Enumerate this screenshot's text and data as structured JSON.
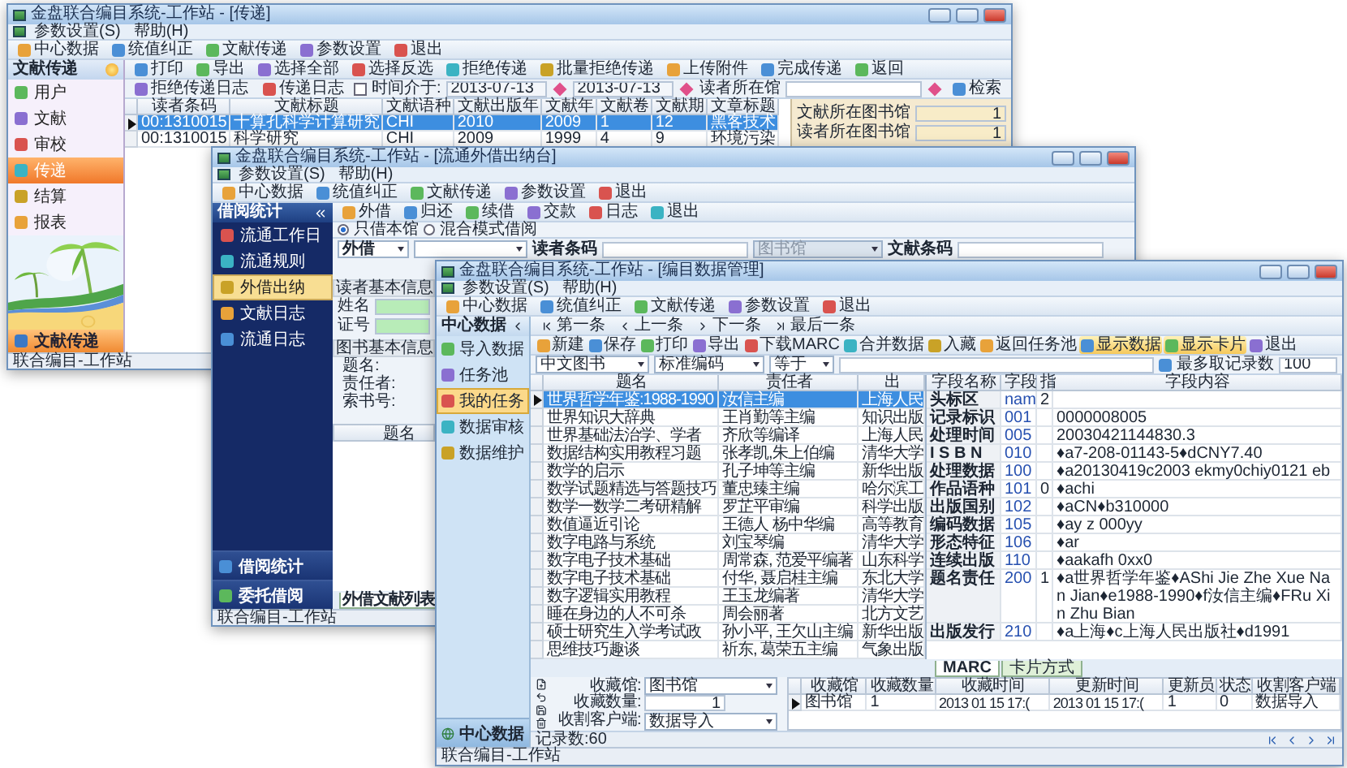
{
  "transfer_window": {
    "title": "金盘联合编目系统-工作站 - [传递]",
    "menu": [
      "参数设置(S)",
      "帮助(H)"
    ],
    "toolbar": [
      "中心数据",
      "统值纠正",
      "文献传递",
      "参数设置",
      "退出"
    ],
    "sidebar": {
      "title": "文献传递",
      "items": [
        {
          "label": "用户",
          "selected": false
        },
        {
          "label": "文献",
          "selected": false
        },
        {
          "label": "审校",
          "selected": false
        },
        {
          "label": "传递",
          "selected": true
        },
        {
          "label": "结算",
          "selected": false
        },
        {
          "label": "报表",
          "selected": false
        }
      ],
      "footer": "文献传递"
    },
    "actions": [
      "打印",
      "导出",
      "选择全部",
      "选择反选",
      "拒绝传递",
      "批量拒绝传递",
      "上传附件",
      "完成传递",
      "返回"
    ],
    "filter": {
      "log_buttons": [
        "拒绝传递日志",
        "传递日志"
      ],
      "checkbox": {
        "label": "时间介于:",
        "checked": false
      },
      "date_from": "2013-07-13",
      "date_to": "2013-07-13",
      "reader_library_label": "读者所在馆",
      "search": "检索"
    },
    "table": {
      "columns": [
        "读者条码",
        "文献标题",
        "文献语种",
        "文献出版年",
        "文献年",
        "文献卷",
        "文献期",
        "文章标题"
      ],
      "rows": [
        {
          "selected": true,
          "cells": [
            "00:1310015",
            "十算孔科学计算研究",
            "CHI",
            "2010",
            "2009",
            "1",
            "12",
            "黑客技术"
          ]
        },
        {
          "selected": false,
          "cells": [
            "00:1310015",
            "科学研究",
            "CHI",
            "2009",
            "1999",
            "4",
            "9",
            "环境污染"
          ]
        }
      ]
    },
    "info": [
      {
        "label": "文献所在图书馆",
        "value": "1"
      },
      {
        "label": "读者所在图书馆",
        "value": "1"
      }
    ],
    "status": "联合编目-工作站"
  },
  "circulation_window": {
    "title": "金盘联合编目系统-工作站 - [流通外借出纳台]",
    "menu": [
      "参数设置(S)",
      "帮助(H)"
    ],
    "toolbar": [
      "中心数据",
      "统值纠正",
      "文献传递",
      "参数设置",
      "退出"
    ],
    "sidebar": {
      "title": "借阅统计",
      "items": [
        {
          "label": "流通工作日",
          "selected": false
        },
        {
          "label": "流通规则",
          "selected": false
        },
        {
          "label": "外借出纳",
          "selected": true
        },
        {
          "label": "文献日志",
          "selected": false
        },
        {
          "label": "流通日志",
          "selected": false
        }
      ],
      "footer": [
        "借阅统计",
        "委托借阅"
      ]
    },
    "actions": [
      "外借",
      "归还",
      "续借",
      "交款",
      "日志",
      "退出"
    ],
    "modes": [
      {
        "label": "只借本馆",
        "selected": true
      },
      {
        "label": "混合模式借阅",
        "selected": false
      }
    ],
    "loan_type": "外借",
    "reader_barcode_label": "读者条码",
    "library_placeholder": "图书馆",
    "item_barcode_label": "文献条码",
    "reader_section": "读者基本信息",
    "reader_fields": [
      "姓名",
      "证号"
    ],
    "book_section": "图书基本信息",
    "book_fields": [
      "题名:",
      "责任者:",
      "索书号:"
    ],
    "list_column": "题名",
    "tab": "外借文献列表",
    "status": "联合编目-工作站"
  },
  "cataloging_window": {
    "title": "金盘联合编目系统-工作站 - [编目数据管理]",
    "menu": [
      "参数设置(S)",
      "帮助(H)"
    ],
    "toolbar": [
      "中心数据",
      "统值纠正",
      "文献传递",
      "参数设置",
      "退出"
    ],
    "sidebar": {
      "title": "中心数据",
      "items": [
        {
          "label": "导入数据",
          "selected": false
        },
        {
          "label": "任务池",
          "selected": false
        },
        {
          "label": "我的任务",
          "selected": true
        },
        {
          "label": "数据审核",
          "selected": false
        },
        {
          "label": "数据维护",
          "selected": false
        }
      ],
      "footer": "中心数据"
    },
    "navigation": [
      "第一条",
      "上一条",
      "下一条",
      "最后一条"
    ],
    "actions": [
      {
        "label": "新建",
        "selected": false
      },
      {
        "label": "保存",
        "selected": false
      },
      {
        "label": "打印",
        "selected": false
      },
      {
        "label": "导出",
        "selected": false
      },
      {
        "label": "下载MARC",
        "selected": false
      },
      {
        "label": "合并数据",
        "selected": false
      },
      {
        "label": "入藏",
        "selected": false
      },
      {
        "label": "返回任务池",
        "selected": false
      },
      {
        "label": "显示数据",
        "selected": true
      },
      {
        "label": "显示卡片",
        "selected": true
      },
      {
        "label": "退出",
        "selected": false
      }
    ],
    "filter": {
      "type": "中文图书",
      "field": "标准编码",
      "operator": "等于",
      "max_label": "最多取记录数",
      "max_value": "100"
    },
    "records": {
      "columns": [
        "题名",
        "责任者",
        "出"
      ],
      "rows": [
        {
          "selected": true,
          "cells": [
            "世界哲学年鉴:1988-1990",
            "汝信主编",
            "上海人民"
          ]
        },
        {
          "selected": false,
          "cells": [
            "世界知识大辞典",
            "王肖勤等主编",
            "知识出版"
          ]
        },
        {
          "selected": false,
          "cells": [
            "世界基础法治学、学者",
            "齐欣等编译",
            "上海人民"
          ]
        },
        {
          "selected": false,
          "cells": [
            "数据结构实用教程习题",
            "张孝凯,朱上伯编",
            "清华大学"
          ]
        },
        {
          "selected": false,
          "cells": [
            "数学的启示",
            "孔子坤等主编",
            "新华出版"
          ]
        },
        {
          "selected": false,
          "cells": [
            "数学试题精选与答题技巧",
            "董忠臻主编",
            "哈尔滨工"
          ]
        },
        {
          "selected": false,
          "cells": [
            "数学一数学二考研精解",
            "罗芷平审编",
            "科学出版"
          ]
        },
        {
          "selected": false,
          "cells": [
            "数值逼近引论",
            "王德人 杨中华编",
            "高等教育"
          ]
        },
        {
          "selected": false,
          "cells": [
            "数字电路与系统",
            "刘宝琴编",
            "清华大学"
          ]
        },
        {
          "selected": false,
          "cells": [
            "数字电子技术基础",
            "周常森, 范爱平编著",
            "山东科学"
          ]
        },
        {
          "selected": false,
          "cells": [
            "数字电子技术基础",
            "付华, 聂启桂主编",
            "东北大学"
          ]
        },
        {
          "selected": false,
          "cells": [
            "数字逻辑实用教程",
            "王玉龙编著",
            "清华大学"
          ]
        },
        {
          "selected": false,
          "cells": [
            "睡在身边的人不可杀",
            "周会丽著",
            "北方文艺"
          ]
        },
        {
          "selected": false,
          "cells": [
            "硕士研究生入学考试政",
            "孙小平, 王欠山主编",
            "新华出版"
          ]
        },
        {
          "selected": false,
          "cells": [
            "思维技巧趣谈",
            "祈东, 葛荣五主编",
            "气象出版"
          ]
        }
      ]
    },
    "marc": {
      "columns": [
        "字段名称",
        "字段",
        "指",
        "字段内容"
      ],
      "rows": [
        {
          "name": "头标区",
          "tag": "nam",
          "indicator": "2"
        },
        {
          "name": "记录标识",
          "tag": "001",
          "content": "0000008005"
        },
        {
          "name": "处理时间",
          "tag": "005",
          "content": "20030421144830.3"
        },
        {
          "name": "I S B N",
          "tag": "010",
          "content": "♦a7-208-01143-5♦dCNY7.40"
        },
        {
          "name": "处理数据",
          "tag": "100",
          "content": "♦a20130419c2003 ekmy0chiy0121 eb"
        },
        {
          "name": "作品语种",
          "tag": "101",
          "indicator": "0",
          "content": "♦achi"
        },
        {
          "name": "出版国别",
          "tag": "102",
          "content": "♦aCN♦b310000"
        },
        {
          "name": "编码数据",
          "tag": "105",
          "content": "♦ay z 000yy"
        },
        {
          "name": "形态特征",
          "tag": "106",
          "content": "♦ar"
        },
        {
          "name": "连续出版",
          "tag": "110",
          "content": "♦aakafh 0xx0"
        },
        {
          "name": "题名责任",
          "tag": "200",
          "indicator": "1",
          "content": "♦a世界哲学年鉴♦AShi Jie Zhe Xue Nan Jian♦e1988-1990♦f汝信主编♦FRu Xin Zhu Bian"
        },
        {
          "name": "出版发行",
          "tag": "210",
          "content": "♦a上海♦c上海人民出版社♦d1991"
        }
      ]
    },
    "tabs": [
      {
        "label": "MARC",
        "selected": true
      },
      {
        "label": "卡片方式",
        "selected": false
      }
    ],
    "holding_form": [
      {
        "kind": "select",
        "label": "收藏馆:",
        "value": "图书馆"
      },
      {
        "kind": "number",
        "label": "收藏数量:",
        "value": "1"
      },
      {
        "kind": "select",
        "label": "收割客户端:",
        "value": "数据导入"
      }
    ],
    "holdings": {
      "columns": [
        "收藏馆",
        "收藏数量",
        "收藏时间",
        "更新时间",
        "更新员",
        "状态",
        "收割客户端"
      ],
      "rows": [
        {
          "cells": [
            "图书馆",
            "1",
            "2013 01 15 17:(",
            "2013 01 15 17:(",
            "1",
            "0",
            "数据导入"
          ]
        }
      ]
    },
    "record_count": "记录数:60",
    "status": "联合编目-工作站"
  }
}
